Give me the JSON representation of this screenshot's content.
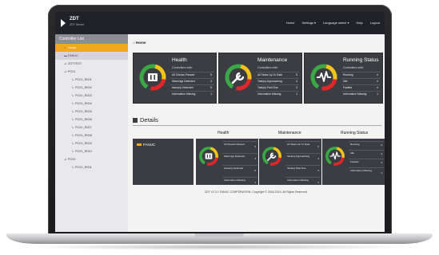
{
  "app": {
    "brand_title": "ZDT",
    "brand_sub": "ZDT Server",
    "nav": [
      "Home",
      "Settings ▾",
      "Language select ▾",
      "Help",
      "Logout"
    ]
  },
  "sidebar": {
    "header": "Controller List",
    "items": [
      {
        "label": "Home",
        "level": 0,
        "icon": "home-icon",
        "state": "active"
      },
      {
        "label": "FANUC",
        "level": 0,
        "icon": "folder-icon",
        "state": "selected"
      },
      {
        "label": "ZDTTEST",
        "level": 0,
        "icon": "tree-icon",
        "state": ""
      },
      {
        "label": "PC01",
        "level": 1,
        "icon": "tree-icon",
        "state": ""
      },
      {
        "label": "PC01_R001",
        "level": 2,
        "icon": "robot-icon",
        "state": ""
      },
      {
        "label": "PC01_R002",
        "level": 2,
        "icon": "robot-icon",
        "state": ""
      },
      {
        "label": "PC01_R003",
        "level": 2,
        "icon": "robot-icon",
        "state": ""
      },
      {
        "label": "PC01_R004",
        "level": 2,
        "icon": "robot-icon",
        "state": ""
      },
      {
        "label": "PC01_R005",
        "level": 2,
        "icon": "robot-icon",
        "state": ""
      },
      {
        "label": "PC01_R006",
        "level": 2,
        "icon": "robot-icon",
        "state": ""
      },
      {
        "label": "PC01_R007",
        "level": 2,
        "icon": "robot-icon",
        "state": ""
      },
      {
        "label": "PC01_R008",
        "level": 2,
        "icon": "robot-icon",
        "state": ""
      },
      {
        "label": "PC01_R009",
        "level": 2,
        "icon": "robot-icon",
        "state": ""
      },
      {
        "label": "PC01_R010",
        "level": 2,
        "icon": "robot-icon",
        "state": ""
      },
      {
        "label": "PC02",
        "level": 1,
        "icon": "tree-icon",
        "state": ""
      },
      {
        "label": "PC02_R001",
        "level": 2,
        "icon": "robot-icon",
        "state": ""
      }
    ]
  },
  "breadcrumb": "Home",
  "cards": {
    "health": {
      "title": "Health",
      "subtitle": "Controllers with:",
      "rows": [
        {
          "label": "All Checks Passed",
          "count": "5"
        },
        {
          "label": "Warnings Detected",
          "count": "3"
        },
        {
          "label": "Issue(s) Detected",
          "count": "5"
        },
        {
          "label": "Information Missing",
          "count": "1"
        }
      ]
    },
    "maintenance": {
      "title": "Maintenance",
      "subtitle": "Controllers with:",
      "rows": [
        {
          "label": "All Tasks Up To Date",
          "count": "5"
        },
        {
          "label": "Task(s) Approaching",
          "count": "4"
        },
        {
          "label": "Task(s) Past Due",
          "count": "3"
        },
        {
          "label": "Information Missing",
          "count": "1"
        }
      ]
    },
    "running": {
      "title": "Running Status",
      "subtitle": "Controllers with:",
      "rows": [
        {
          "label": "Running",
          "count": "4"
        },
        {
          "label": "Idle",
          "count": "4"
        },
        {
          "label": "Faulted",
          "count": "4"
        },
        {
          "label": "Information Missing",
          "count": "1"
        }
      ]
    }
  },
  "details": {
    "title": "Details",
    "col_health": "Health",
    "col_maintenance": "Maintenance",
    "col_running": "Running Status",
    "device": "FANUC",
    "health_rows": [
      {
        "label": "All Checks Passed",
        "count": "5"
      },
      {
        "label": "Warnings Detected",
        "count": "3"
      },
      {
        "label": "Issue(s) Detected",
        "count": "5"
      },
      {
        "label": "Information Missing",
        "count": "1"
      }
    ],
    "maintenance_rows": [
      {
        "label": "All Tasks Up To Date",
        "count": "5"
      },
      {
        "label": "Task(s) Approaching",
        "count": "4"
      },
      {
        "label": "Task(s) Past Due",
        "count": "3"
      },
      {
        "label": "Information Missing",
        "count": "1"
      }
    ],
    "running_rows": [
      {
        "label": "Running",
        "count": "4"
      },
      {
        "label": "Idle",
        "count": "4"
      },
      {
        "label": "Faulted",
        "count": "4"
      },
      {
        "label": "Information Missing",
        "count": "1"
      }
    ]
  },
  "footer": "ZDT V2.3.1   FANUC CORPORATION. Copyright © 2016-2019. All Rights Reserved.",
  "colors": {
    "accent": "#f0a81e",
    "panel": "#3b3d42",
    "topbar": "#1f2228",
    "gauge_green": "#3aa845",
    "gauge_yellow": "#f2c318",
    "gauge_red": "#e0262a"
  }
}
